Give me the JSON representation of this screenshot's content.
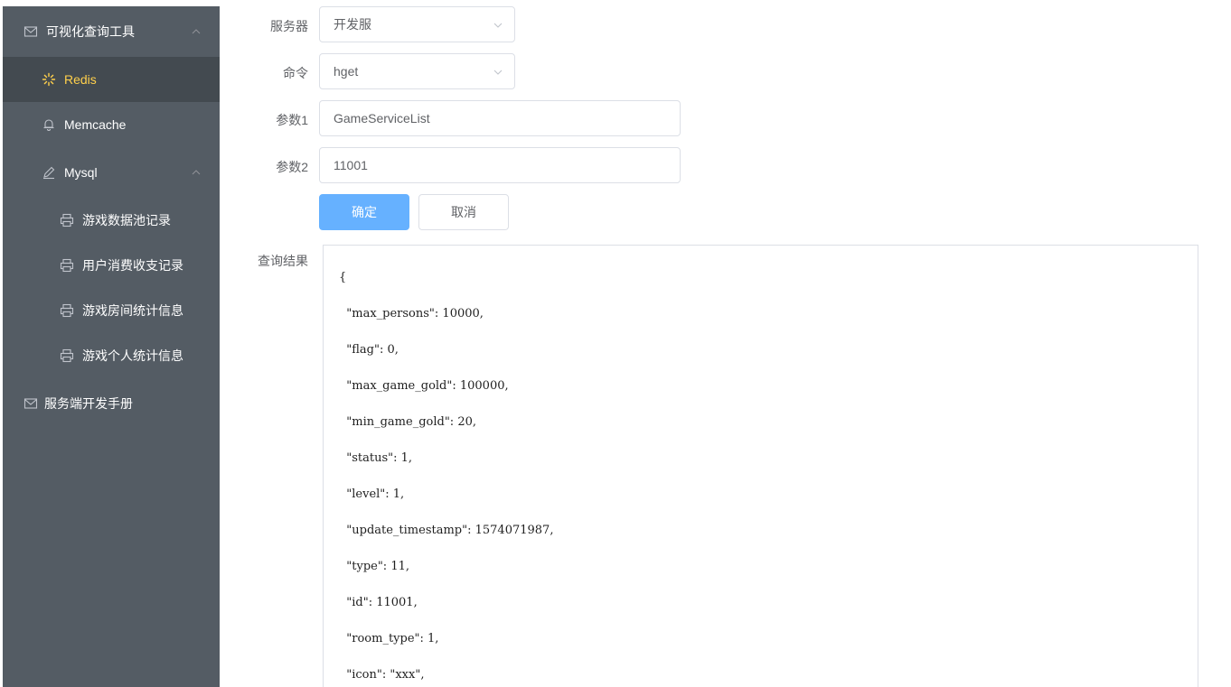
{
  "sidebar": {
    "group1": {
      "label": "可视化查询工具",
      "icon": "mail-icon"
    },
    "items": [
      {
        "label": "Redis",
        "icon": "loading-icon"
      },
      {
        "label": "Memcache",
        "icon": "bell-icon"
      },
      {
        "label": "Mysql",
        "icon": "edit-icon"
      }
    ],
    "mysql_children": [
      {
        "label": "游戏数据池记录",
        "icon": "printer-icon"
      },
      {
        "label": "用户消费收支记录",
        "icon": "printer-icon"
      },
      {
        "label": "游戏房间统计信息",
        "icon": "printer-icon"
      },
      {
        "label": "游戏个人统计信息",
        "icon": "printer-icon"
      }
    ],
    "group2": {
      "label": "服务端开发手册",
      "icon": "mail-icon"
    }
  },
  "form": {
    "server": {
      "label": "服务器",
      "value": "开发服"
    },
    "command": {
      "label": "命令",
      "value": "hget"
    },
    "param1": {
      "label": "参数1",
      "value": "GameServiceList"
    },
    "param2": {
      "label": "参数2",
      "value": "11001"
    },
    "confirm_label": "确定",
    "cancel_label": "取消"
  },
  "result": {
    "label": "查询结果",
    "lines": [
      "{",
      "  \"max_persons\": 10000,",
      "  \"flag\": 0,",
      "  \"max_game_gold\": 100000,",
      "  \"min_game_gold\": 20,",
      "  \"status\": 1,",
      "  \"level\": 1,",
      "  \"update_timestamp\": 1574071987,",
      "  \"type\": 11,",
      "  \"id\": 11001,",
      "  \"room_type\": 1,",
      "  \"icon\": \"xxx\","
    ]
  },
  "colors": {
    "sidebar_bg": "#545c64",
    "active_bg": "#434a50",
    "active_text": "#ffd04b",
    "primary": "#66b1ff"
  }
}
